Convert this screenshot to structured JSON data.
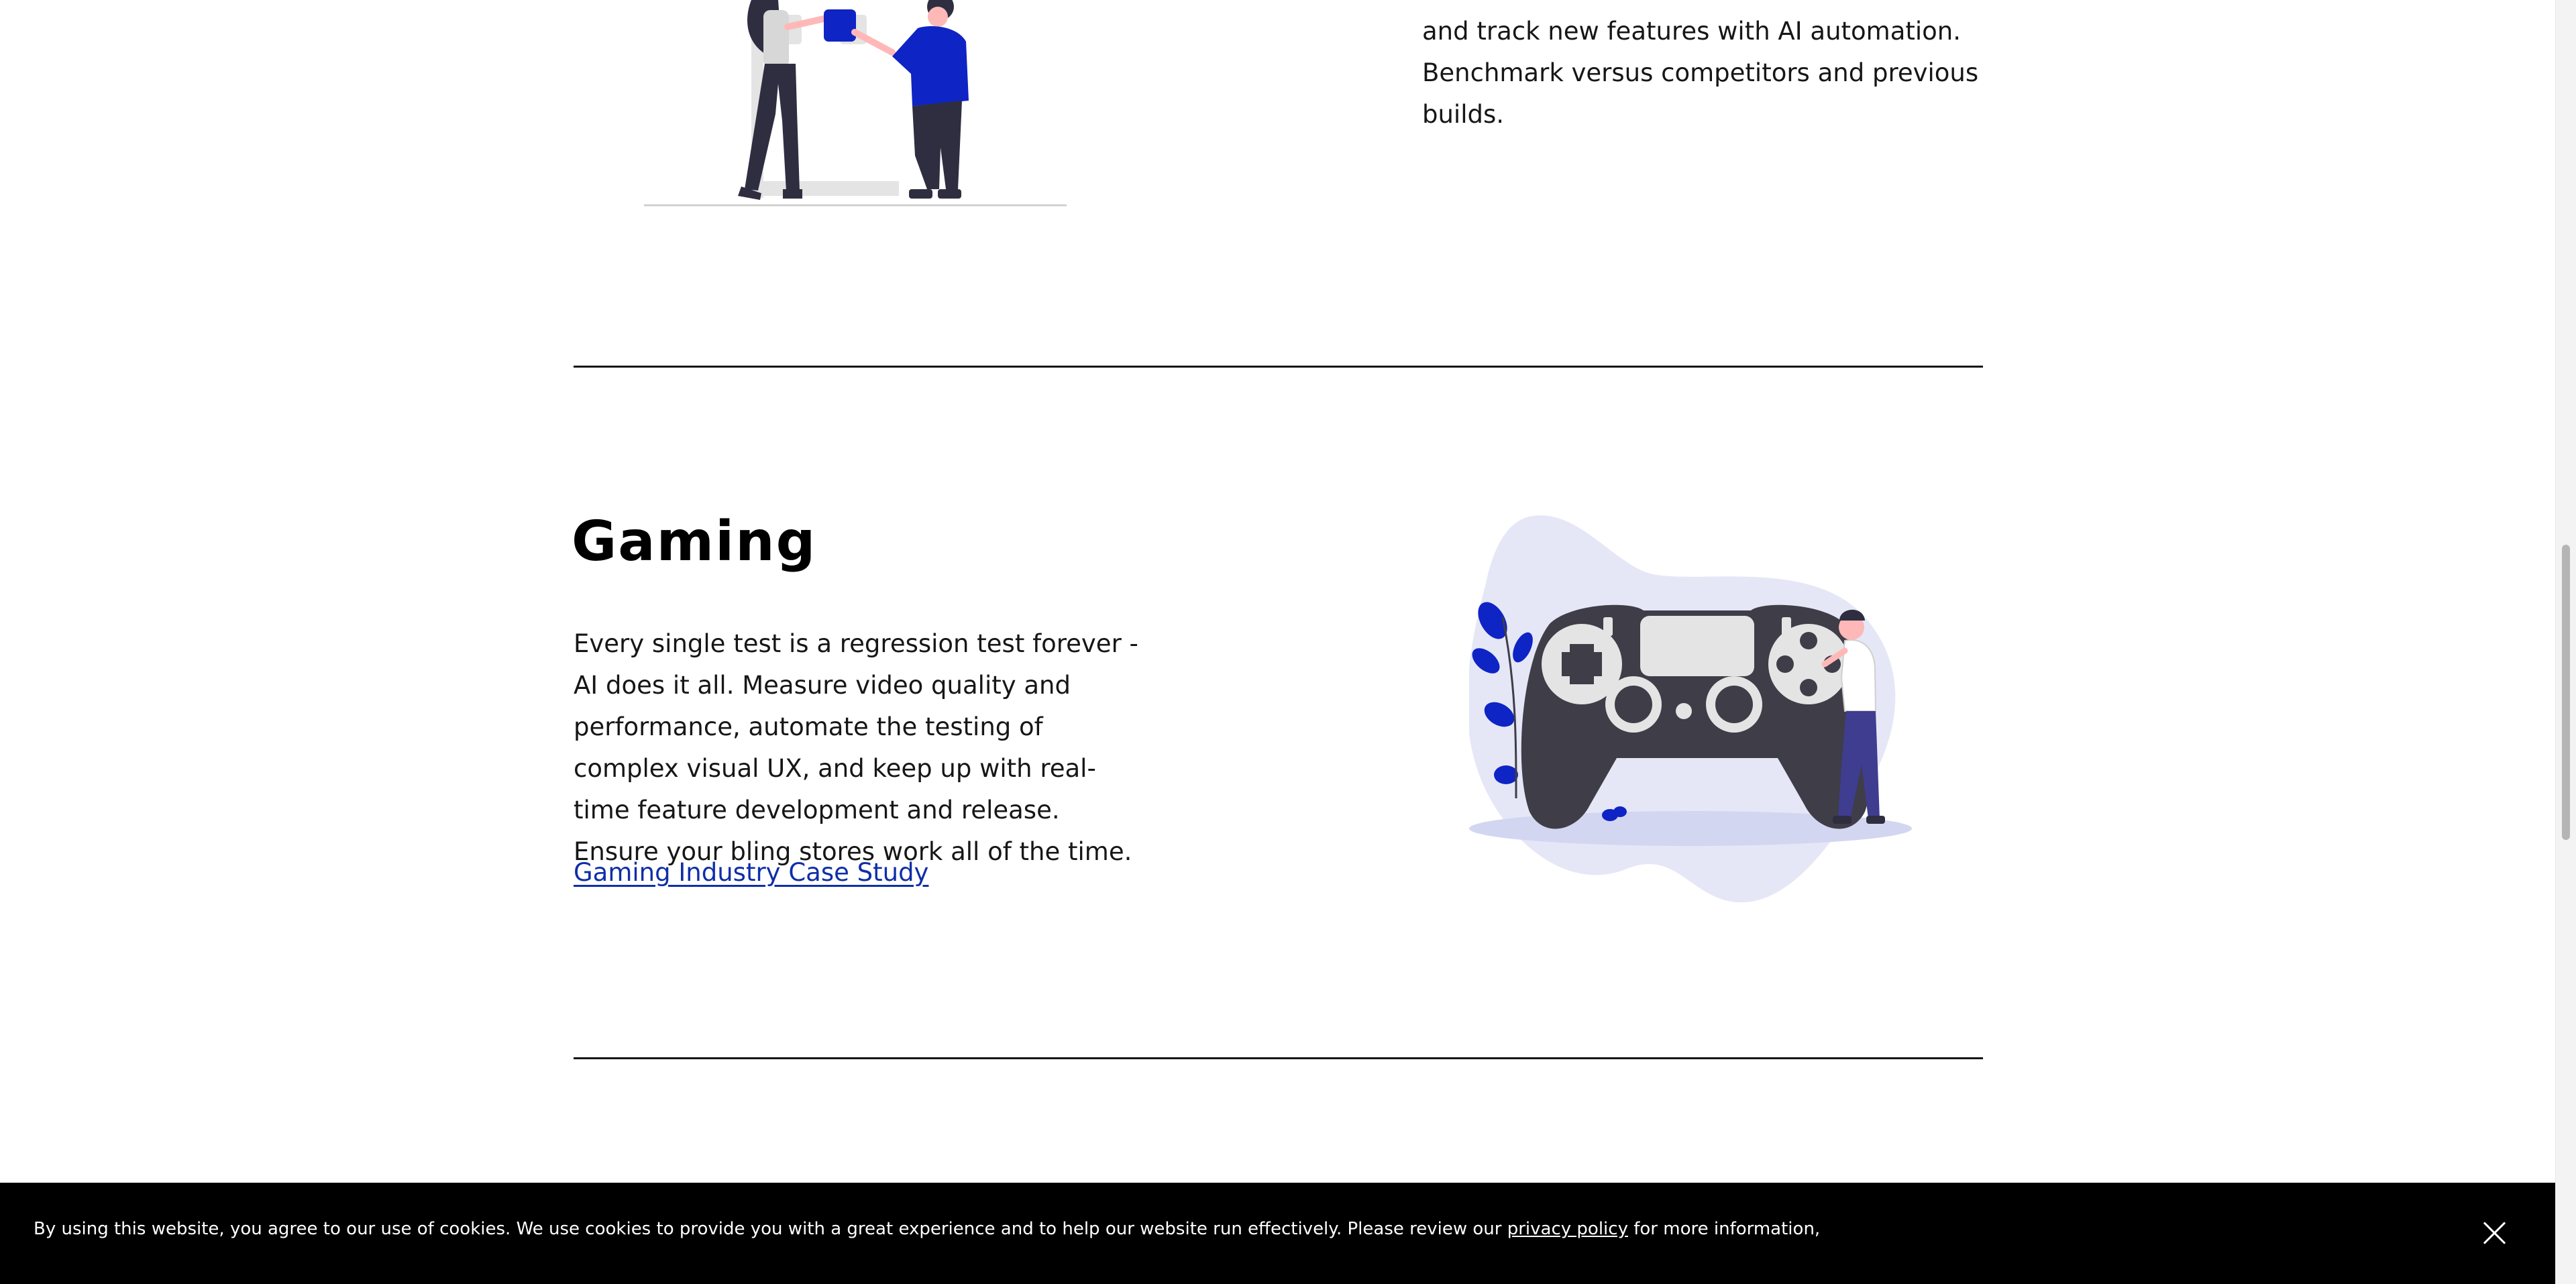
{
  "section_top": {
    "text_lines": [
      "and track new features with AI automation.",
      "Benchmark versus competitors and previous builds."
    ],
    "illustration": "two-people-assembling-blocks-illustration"
  },
  "gaming": {
    "title": "Gaming",
    "body": "Every single test is a regression test forever - AI does it all. Measure video quality and performance, automate the testing of complex visual UX, and keep up with real-time feature development and release. Ensure your bling stores work all of the time.",
    "link_label": "Gaming Industry Case Study",
    "illustration": "game-controller-illustration"
  },
  "cookie_banner": {
    "text_before": "By using this website, you agree to our use of cookies. We use cookies to provide you with a great experience and to help our website run effectively. Please review our ",
    "link_label": "privacy policy",
    "text_after": " for more information,",
    "close_icon": "close-icon"
  },
  "colors": {
    "accent": "#0f2ea8",
    "illustration_blue": "#0f24c4",
    "blob": "#e5e7f7",
    "controller": "#3f3d47",
    "cookie_bg": "#000000"
  }
}
